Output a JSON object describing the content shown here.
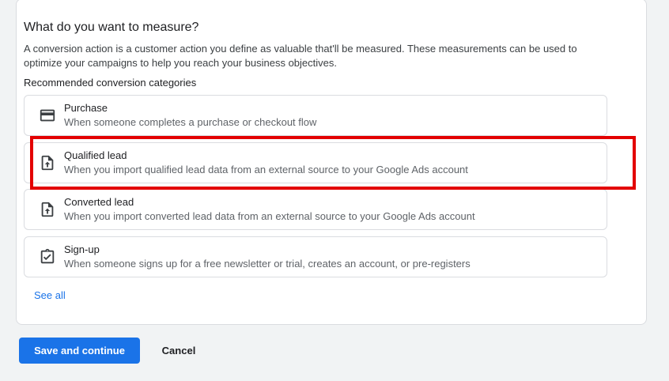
{
  "section_title": "What do you want to measure?",
  "description": "A conversion action is a customer action you define as valuable that'll be measured. These measurements can be used to optimize your campaigns to help you reach your business objectives.",
  "recommended_label": "Recommended conversion categories",
  "options": [
    {
      "icon": "credit-card-icon",
      "title": "Purchase",
      "subtitle": "When someone completes a purchase or checkout flow"
    },
    {
      "icon": "file-upload-icon",
      "title": "Qualified lead",
      "subtitle": "When you import qualified lead data from an external source to your Google Ads account",
      "highlighted": true
    },
    {
      "icon": "file-upload-icon",
      "title": "Converted lead",
      "subtitle": "When you import converted lead data from an external source to your Google Ads account"
    },
    {
      "icon": "clipboard-check-icon",
      "title": "Sign-up",
      "subtitle": "When someone signs up for a free newsletter or trial, creates an account, or pre-registers"
    }
  ],
  "see_all_label": "See all",
  "buttons": {
    "save_label": "Save and continue",
    "cancel_label": "Cancel"
  },
  "colors": {
    "accent": "#1a73e8",
    "highlight": "#e30000",
    "background": "#f1f3f4"
  }
}
